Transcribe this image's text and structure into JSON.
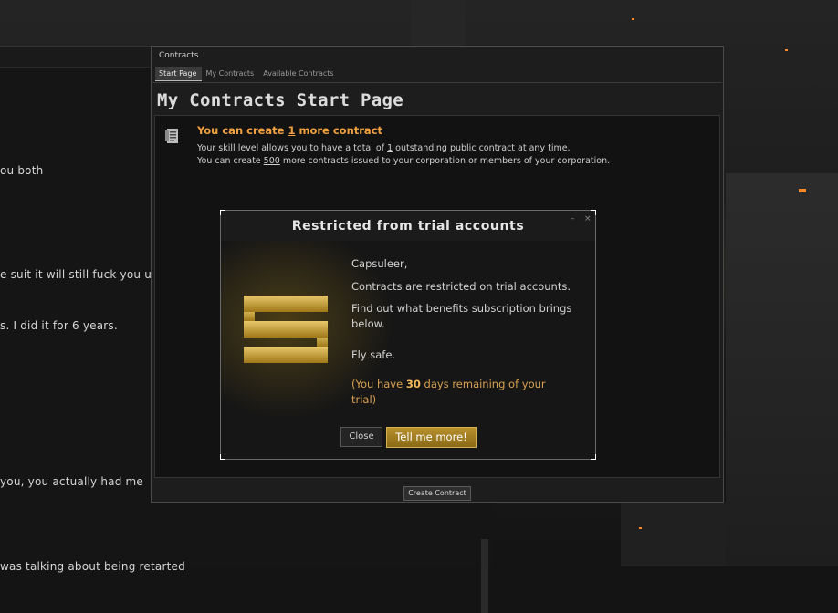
{
  "chat": {
    "lines": [
      "ou both",
      "e suit it will still fuck you u",
      "s. I did it for 6 years.",
      " you, you actually had me",
      "was talking about being retarted"
    ]
  },
  "contracts_window": {
    "title": "Contracts",
    "tabs": [
      "Start Page",
      "My Contracts",
      "Available Contracts"
    ],
    "heading": "My Contracts Start Page",
    "info": {
      "title_prefix": "You can create ",
      "title_count": "1",
      "title_suffix": " more contract",
      "line1_prefix": "Your skill level allows you to have a total of ",
      "line1_count": "1",
      "line1_suffix": " outstanding public contract at any time.",
      "line2_prefix": "You can create ",
      "line2_count": "500",
      "line2_suffix": " more contracts issued to your corporation or members of your corporation."
    },
    "create_button": "Create Contract"
  },
  "modal": {
    "title": "Restricted from trial accounts",
    "minimize": "–",
    "close_x": "×",
    "greeting": "Capsuleer,",
    "restricted": "Contracts are restricted on trial accounts.",
    "find_out": "Find out what benefits subscription brings below.",
    "fly_safe": "Fly safe.",
    "trial_prefix": "(You have ",
    "trial_days": "30",
    "trial_suffix": " days remaining of your trial)",
    "close_button": "Close",
    "more_button": "Tell me more!"
  },
  "colors": {
    "accent_orange": "#f0a040",
    "gold_button": "#a07820"
  },
  "icons": [
    "document-icon",
    "omega-logo-icon",
    "minimize-icon",
    "close-icon"
  ]
}
